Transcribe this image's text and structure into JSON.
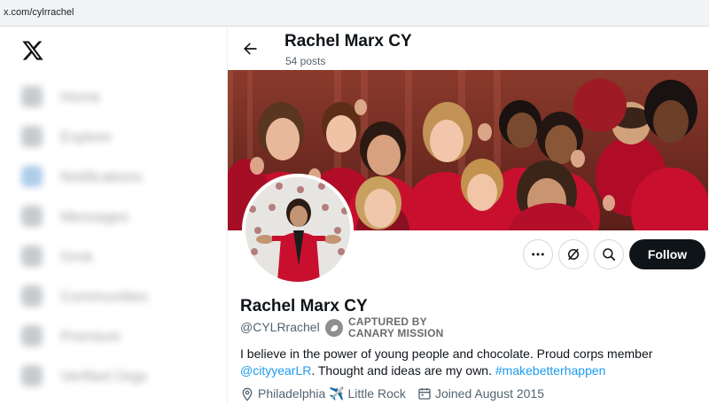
{
  "browser": {
    "url": "x.com/cylrrachel"
  },
  "sidebar": {
    "items": [
      {
        "label": "Home",
        "icon": "home-icon"
      },
      {
        "label": "Explore",
        "icon": "search-icon"
      },
      {
        "label": "Notifications",
        "icon": "bell-icon"
      },
      {
        "label": "Messages",
        "icon": "mail-icon"
      },
      {
        "label": "Grok",
        "icon": "grok-icon"
      },
      {
        "label": "Communities",
        "icon": "people-icon"
      },
      {
        "label": "Premium",
        "icon": "x-icon"
      },
      {
        "label": "Verified Orgs",
        "icon": "lightning-icon"
      }
    ]
  },
  "header": {
    "name": "Rachel Marx CY",
    "posts": "54 posts"
  },
  "profile": {
    "name": "Rachel Marx CY",
    "handle": "@CYLRrachel",
    "badge_line1": "CAPTURED BY",
    "badge_line2": "CANARY MISSION",
    "bio_part1": "I believe in the power of young people and chocolate. Proud corps member ",
    "bio_link1": "@cityyearLR",
    "bio_part2": ". Thought and ideas are my own. ",
    "bio_link2": "#makebetterhappen",
    "location": "Philadelphia ✈️ Little Rock",
    "joined": "Joined August 2015"
  },
  "actions": {
    "follow_label": "Follow",
    "more_icon": "more-icon",
    "grok_icon": "grok-icon",
    "search_icon": "search-icon"
  },
  "colors": {
    "accent": "#1d9bf0",
    "follow_bg": "#0f1419",
    "city_year_red": "#c8102e"
  }
}
